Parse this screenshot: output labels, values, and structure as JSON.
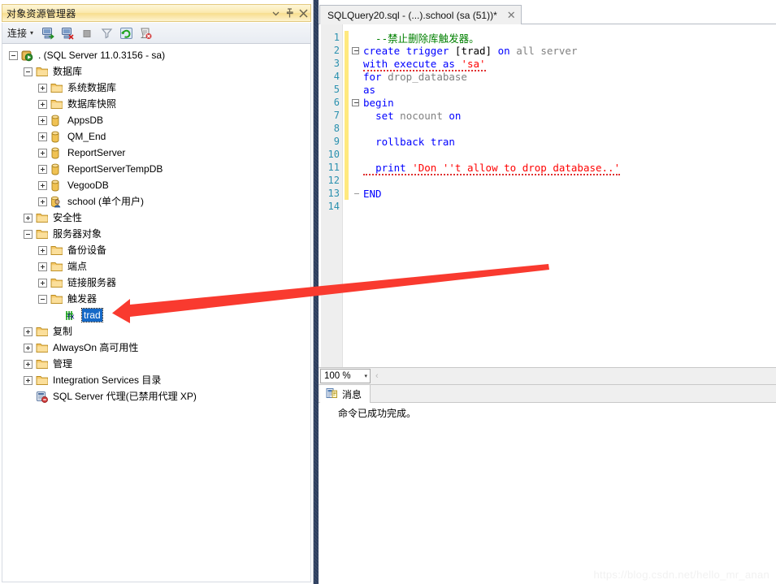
{
  "object_explorer": {
    "title": "对象资源管理器",
    "titlebar_buttons": [
      {
        "name": "dropdown-icon",
        "glyph": "▾"
      },
      {
        "name": "pin-icon",
        "glyph": "⚲"
      },
      {
        "name": "close-icon",
        "glyph": "✕"
      }
    ],
    "toolbar": {
      "connect_label": "连接",
      "connect_caret": "▾",
      "buttons": [
        {
          "name": "connect-object-explorer-icon"
        },
        {
          "name": "disconnect-object-explorer-icon"
        },
        {
          "name": "stop-icon"
        },
        {
          "name": "filter-icon"
        },
        {
          "name": "refresh-icon"
        },
        {
          "name": "script-icon"
        }
      ]
    },
    "tree": [
      {
        "level": 0,
        "state": "minus",
        "icon": "server-icon",
        "label": ". (SQL Server 11.0.3156 - sa)"
      },
      {
        "level": 1,
        "state": "minus",
        "icon": "folder-icon",
        "label": "数据库"
      },
      {
        "level": 2,
        "state": "plus",
        "icon": "folder-icon",
        "label": "系统数据库"
      },
      {
        "level": 2,
        "state": "plus",
        "icon": "folder-icon",
        "label": "数据库快照"
      },
      {
        "level": 2,
        "state": "plus",
        "icon": "database-icon",
        "label": "AppsDB"
      },
      {
        "level": 2,
        "state": "plus",
        "icon": "database-icon",
        "label": "QM_End"
      },
      {
        "level": 2,
        "state": "plus",
        "icon": "database-icon",
        "label": "ReportServer"
      },
      {
        "level": 2,
        "state": "plus",
        "icon": "database-icon",
        "label": "ReportServerTempDB"
      },
      {
        "level": 2,
        "state": "plus",
        "icon": "database-icon",
        "label": "VegooDB"
      },
      {
        "level": 2,
        "state": "plus",
        "icon": "database-user-icon",
        "label": "school (单个用户)"
      },
      {
        "level": 1,
        "state": "plus",
        "icon": "folder-icon",
        "label": "安全性"
      },
      {
        "level": 1,
        "state": "minus",
        "icon": "folder-icon",
        "label": "服务器对象"
      },
      {
        "level": 2,
        "state": "plus",
        "icon": "folder-icon",
        "label": "备份设备"
      },
      {
        "level": 2,
        "state": "plus",
        "icon": "folder-icon",
        "label": "端点"
      },
      {
        "level": 2,
        "state": "plus",
        "icon": "folder-icon",
        "label": "链接服务器"
      },
      {
        "level": 2,
        "state": "minus",
        "icon": "folder-icon",
        "label": "触发器"
      },
      {
        "level": 3,
        "state": "none",
        "icon": "trigger-icon",
        "label": "trad",
        "selected": true
      },
      {
        "level": 1,
        "state": "plus",
        "icon": "folder-icon",
        "label": "复制"
      },
      {
        "level": 1,
        "state": "plus",
        "icon": "folder-icon",
        "label": "AlwaysOn 高可用性"
      },
      {
        "level": 1,
        "state": "plus",
        "icon": "folder-icon",
        "label": "管理"
      },
      {
        "level": 1,
        "state": "plus",
        "icon": "folder-icon",
        "label": "Integration Services 目录"
      },
      {
        "level": 1,
        "state": "none",
        "icon": "agent-disabled-icon",
        "label": "SQL Server 代理(已禁用代理 XP)"
      }
    ]
  },
  "editor": {
    "tab_title": "SQLQuery20.sql - (...).school (sa (51))*",
    "tab_close_glyph": "✕",
    "lines": [
      {
        "n": "1",
        "text": "  --禁止删除库触发器。"
      },
      {
        "n": "2",
        "text": "create trigger [trad] on all server"
      },
      {
        "n": "3",
        "text": "with execute as 'sa'"
      },
      {
        "n": "4",
        "text": "for drop_database"
      },
      {
        "n": "5",
        "text": "as"
      },
      {
        "n": "6",
        "text": "begin"
      },
      {
        "n": "7",
        "text": "  set nocount on"
      },
      {
        "n": "8",
        "text": ""
      },
      {
        "n": "9",
        "text": "  rollback tran"
      },
      {
        "n": "10",
        "text": ""
      },
      {
        "n": "11",
        "text": "  print 'Don ''t allow to drop database..'"
      },
      {
        "n": "12",
        "text": ""
      },
      {
        "n": "13",
        "text": "END"
      },
      {
        "n": "14",
        "text": ""
      }
    ]
  },
  "zoombar": {
    "zoom_value": "100 %",
    "caret_glyph": "▾",
    "nav_glyph": "‹"
  },
  "messages": {
    "tab_label": "消息",
    "tab_icon": "messages-icon",
    "body_text": "命令已成功完成。"
  },
  "annotation": {
    "arrow_color": "#f93a2f",
    "arrow_name": "red-pointer-arrow"
  },
  "watermark": {
    "text": "https://blog.csdn.net/hello_mr_anan"
  }
}
